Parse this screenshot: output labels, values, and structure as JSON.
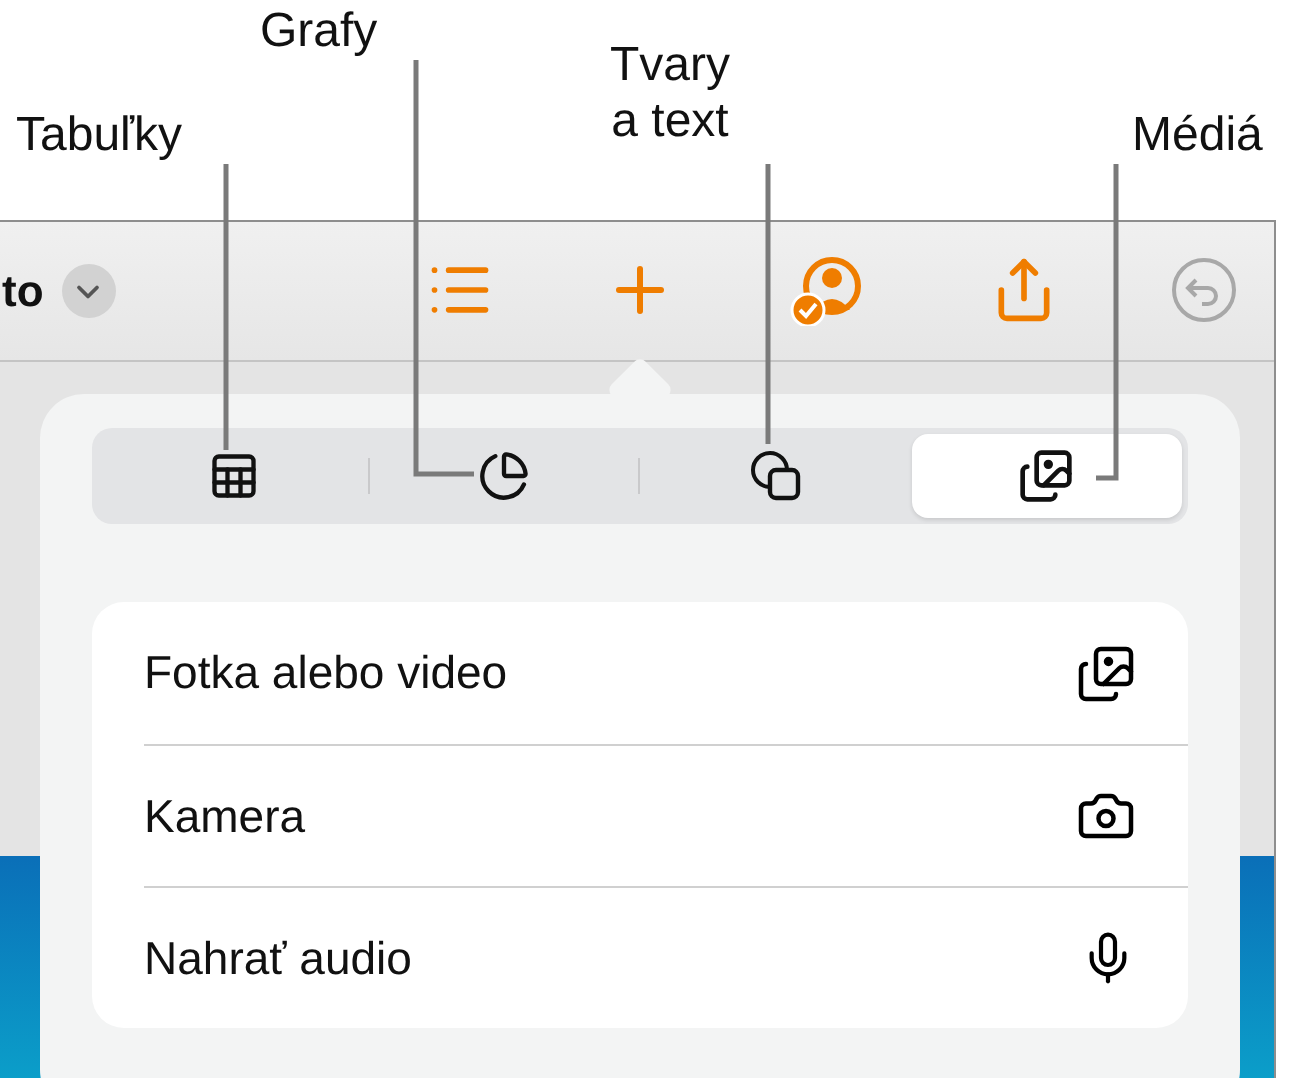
{
  "callouts": [
    {
      "label": "Tabuľky"
    },
    {
      "label": "Grafy"
    },
    {
      "label": "Tvary\na text"
    },
    {
      "label": "Médiá"
    }
  ],
  "toolbar": {
    "document_title": "to",
    "items": [
      {
        "kind": "list"
      },
      {
        "kind": "add"
      },
      {
        "kind": "collaborate"
      },
      {
        "kind": "share"
      },
      {
        "kind": "undo",
        "disabled": true
      }
    ]
  },
  "popover": {
    "tabs": [
      {
        "kind": "table",
        "selected": false
      },
      {
        "kind": "chart",
        "selected": false
      },
      {
        "kind": "shape",
        "selected": false
      },
      {
        "kind": "media",
        "selected": true
      }
    ],
    "items": [
      {
        "label": "Fotka alebo video",
        "kind": "photo"
      },
      {
        "label": "Kamera",
        "kind": "camera"
      },
      {
        "label": "Nahrať audio",
        "kind": "audio"
      }
    ]
  }
}
